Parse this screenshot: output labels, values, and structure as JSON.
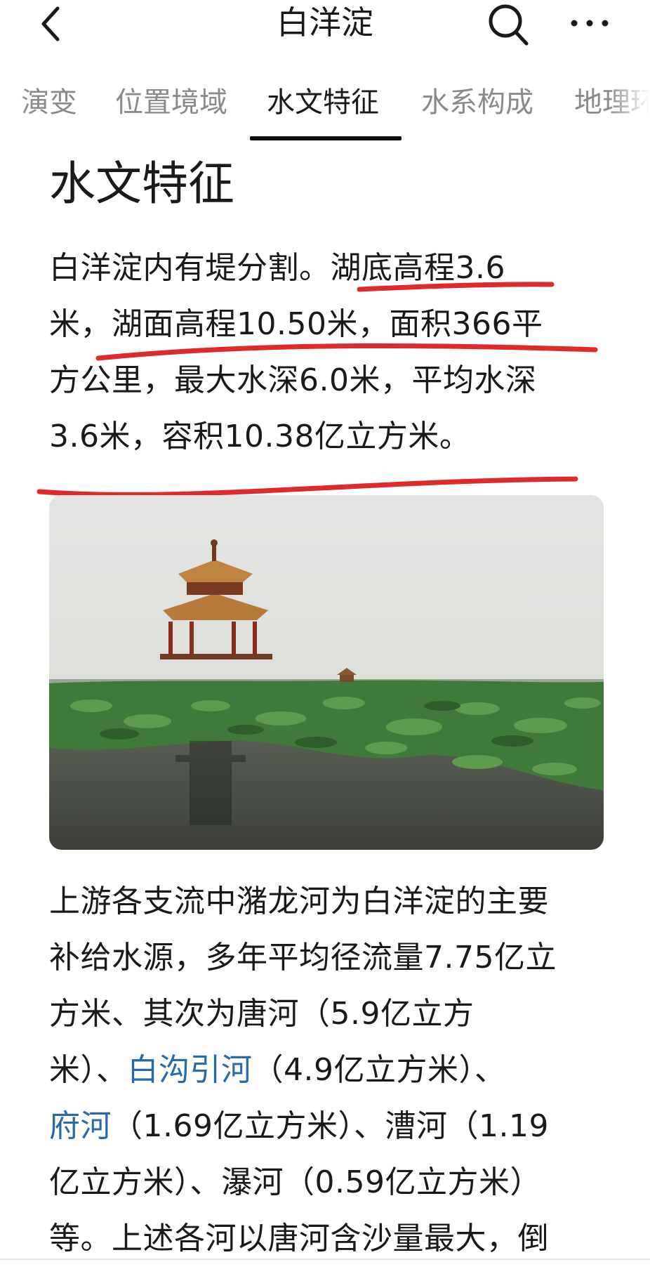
{
  "header": {
    "title": "白洋淀",
    "back_icon": "chevron-left-icon",
    "search_icon": "search-icon",
    "more_icon": "more-horizontal-icon"
  },
  "tabs": [
    {
      "label": "演变",
      "active": false
    },
    {
      "label": "位置境域",
      "active": false
    },
    {
      "label": "水文特征",
      "active": true
    },
    {
      "label": "水系构成",
      "active": false
    },
    {
      "label": "地理环",
      "active": false
    }
  ],
  "section": {
    "heading": "水文特征"
  },
  "paragraph1": {
    "lines": [
      "白洋淀内有堤分割。湖底高程3.6",
      "米，湖面高程10.50米，面积366平",
      "方公里，最大水深6.0米，平均水深",
      "3.6米，容积10.38亿立方米。"
    ]
  },
  "annotation": {
    "color": "#e02a2a"
  },
  "photo": {
    "subject": "lotus-lake-pavilion-image"
  },
  "paragraph2": {
    "line1": "上游各支流中潴龙河为白洋淀的主要",
    "line2": "补给水源，多年平均径流量7.75亿立",
    "line3": "方米、其次为唐河（5.9亿立方",
    "line4_pre": "米）、",
    "line4_link": "白沟引河",
    "line4_post": "（4.9亿立方米）、",
    "line5_link": "府河",
    "line5_post": "（1.69亿立方米）、漕河（1.19",
    "line6": "亿立方米）、瀑河（0.59亿立方米）",
    "line7": "等。上述各河以唐河含沙量最大，倒"
  },
  "colors": {
    "link": "#2a6aa8",
    "text": "#1a1a1a",
    "tab_inactive": "#8a8a8a"
  }
}
